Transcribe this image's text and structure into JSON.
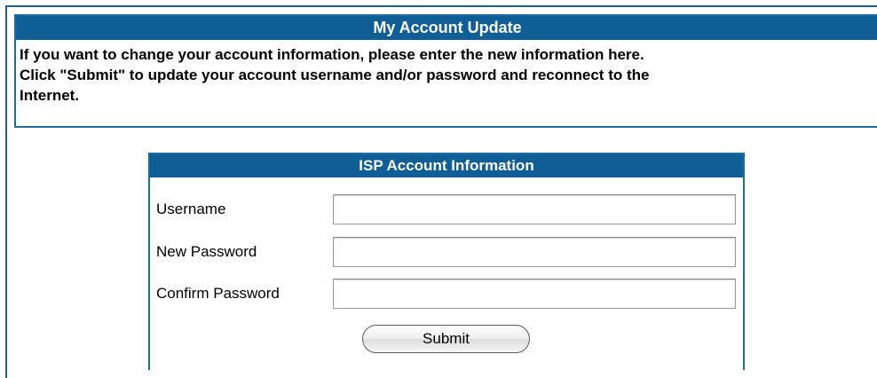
{
  "account_update": {
    "title": "My Account Update",
    "description_line1": "If you want to change your account information, please enter the new information here.",
    "description_line2": "Click \"Submit\" to update your account username and/or password and reconnect to the",
    "description_line3": "Internet."
  },
  "isp_account": {
    "title": "ISP Account Information",
    "fields": [
      {
        "label": "Username",
        "value": "",
        "placeholder": ""
      },
      {
        "label": "New Password",
        "value": "",
        "placeholder": ""
      },
      {
        "label": "Confirm Password",
        "value": "",
        "placeholder": ""
      }
    ],
    "submit_label": "Submit"
  },
  "colors": {
    "header_blue": "#0f5f96",
    "border_blue": "#1f6aa0"
  }
}
